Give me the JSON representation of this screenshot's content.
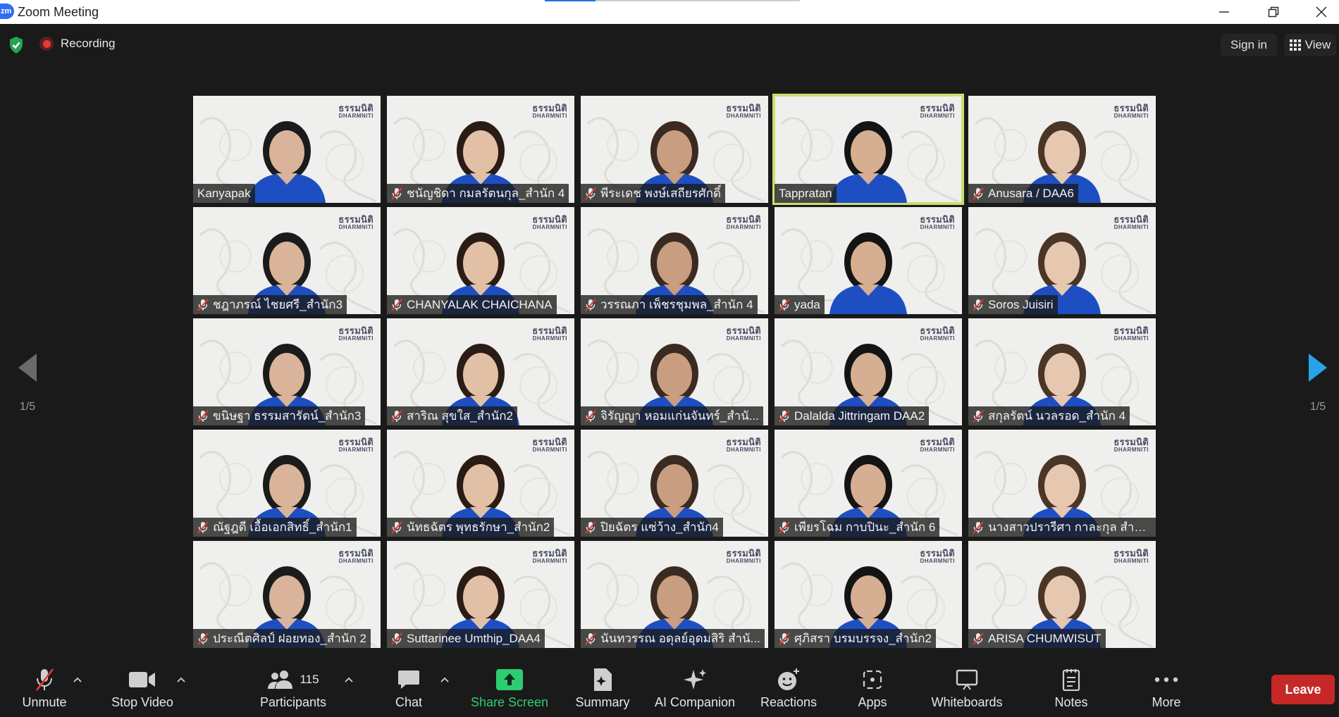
{
  "window": {
    "title": "Zoom Meeting",
    "logo_text": "zm"
  },
  "topbar": {
    "recording_label": "Recording",
    "signin_label": "Sign in",
    "view_label": "View"
  },
  "brand": {
    "thai": "ธรรมนิติ",
    "english": "DHARMNITI"
  },
  "gallery": {
    "page_left": "1/5",
    "page_right": "1/5",
    "participants": [
      {
        "name": "Kanyapak",
        "muted": false,
        "active": false
      },
      {
        "name": "ชนัญชิดา กมลรัตนกุล_สำนัก 4",
        "muted": true,
        "active": false
      },
      {
        "name": "พีระเดช พงษ์เสถียรศักดิ์",
        "muted": true,
        "active": false
      },
      {
        "name": "Tappratan",
        "muted": false,
        "active": true
      },
      {
        "name": "Anusara / DAA6",
        "muted": true,
        "active": false
      },
      {
        "name": "ชฎาภรณ์  ไชยศรี_สำนัก3",
        "muted": true,
        "active": false
      },
      {
        "name": "CHANYALAK CHAICHANA",
        "muted": true,
        "active": false
      },
      {
        "name": "วรรณภา เพ็ชรชุมพล_สำนัก 4",
        "muted": true,
        "active": false
      },
      {
        "name": "yada",
        "muted": true,
        "active": false
      },
      {
        "name": "Soros Juisiri",
        "muted": true,
        "active": false
      },
      {
        "name": "ขนิษฐา ธรรมสารัตน์_สำนัก3",
        "muted": true,
        "active": false
      },
      {
        "name": "สาริณ สุขใส_สำนัก2",
        "muted": true,
        "active": false
      },
      {
        "name": "จิรัญญา หอมแก่นจันทร์_สำนั...",
        "muted": true,
        "active": false
      },
      {
        "name": "Dalalda Jittringam DAA2",
        "muted": true,
        "active": false
      },
      {
        "name": "สกุลรัตน์ นวลรอด_สำนัก 4",
        "muted": true,
        "active": false
      },
      {
        "name": "ณัฐฎดี เอื้อเอกสิทธิ์_สำนัก1",
        "muted": true,
        "active": false
      },
      {
        "name": "นัทธฉัตร พุทธรักษา_สำนัก2",
        "muted": true,
        "active": false
      },
      {
        "name": "ปิยฉัตร แซ่ว้าง_สำนัก4",
        "muted": true,
        "active": false
      },
      {
        "name": "เพียรโฉม กาบปินะ_สำนัก 6",
        "muted": true,
        "active": false
      },
      {
        "name": "นางสาวปรารีศา กาละกุล สำนั...",
        "muted": true,
        "active": false
      },
      {
        "name": "ประณีตศิลป์ ฝอยทอง_สำนัก 2",
        "muted": true,
        "active": false
      },
      {
        "name": "Suttarinee Umthip_DAA4",
        "muted": true,
        "active": false
      },
      {
        "name": "นันทวรรณ อดุลย์อุดมสิริ สำนั...",
        "muted": true,
        "active": false
      },
      {
        "name": "ศุภิสรา บรมบรรจง_สำนัก2",
        "muted": true,
        "active": false
      },
      {
        "name": "ARISA CHUMWISUT",
        "muted": true,
        "active": false
      }
    ]
  },
  "toolbar": {
    "unmute": "Unmute",
    "stop_video": "Stop Video",
    "participants": "Participants",
    "participants_count": "115",
    "chat": "Chat",
    "share_screen": "Share Screen",
    "summary": "Summary",
    "ai_companion": "AI Companion",
    "reactions": "Reactions",
    "apps": "Apps",
    "whiteboards": "Whiteboards",
    "notes": "Notes",
    "more": "More",
    "leave": "Leave"
  },
  "colors": {
    "background": "#1a1a1a",
    "active_speaker_border": "#c6e06e",
    "share_green": "#2ecc71",
    "leave_red": "#c62828",
    "muted_red": "#e53935"
  }
}
